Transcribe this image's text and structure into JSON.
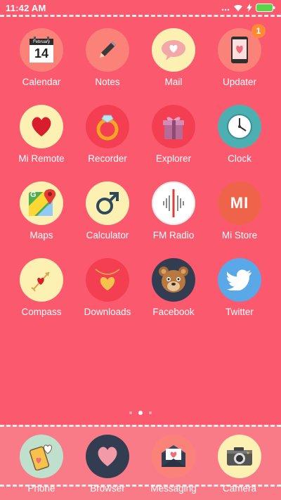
{
  "status_bar": {
    "time": "11:42 AM",
    "icons": [
      "more-icon",
      "wifi-icon",
      "charging-icon",
      "battery-icon"
    ]
  },
  "apps": [
    {
      "label": "Calendar",
      "month": "February",
      "day": "14",
      "icon": "calendar-icon"
    },
    {
      "label": "Notes",
      "icon": "pencil-icon"
    },
    {
      "label": "Mail",
      "icon": "speech-heart-icon"
    },
    {
      "label": "Updater",
      "icon": "phone-heart-icon",
      "badge": "1"
    },
    {
      "label": "Mi Remote",
      "icon": "heart-icon"
    },
    {
      "label": "Recorder",
      "icon": "ring-icon"
    },
    {
      "label": "Explorer",
      "icon": "gift-box-icon"
    },
    {
      "label": "Clock",
      "icon": "clock-icon"
    },
    {
      "label": "Maps",
      "icon": "maps-icon",
      "maps_letter": "G"
    },
    {
      "label": "Calculator",
      "icon": "male-symbol-icon"
    },
    {
      "label": "FM Radio",
      "icon": "radio-wave-icon"
    },
    {
      "label": "Mi Store",
      "icon": "mi-logo-icon",
      "logo_text": "MI"
    },
    {
      "label": "Compass",
      "icon": "arrow-heart-icon"
    },
    {
      "label": "Downloads",
      "icon": "heart-necklace-icon"
    },
    {
      "label": "Facebook",
      "icon": "teddy-bear-icon"
    },
    {
      "label": "Twitter",
      "icon": "twitter-bird-icon"
    }
  ],
  "page_indicator": {
    "pages": 3,
    "current": 2
  },
  "dock": [
    {
      "label": "Phone",
      "icon": "phone-hearts-icon"
    },
    {
      "label": "Browser",
      "icon": "heart-icon"
    },
    {
      "label": "Messaging",
      "icon": "envelope-heart-icon"
    },
    {
      "label": "Camera",
      "icon": "camera-icon"
    }
  ],
  "colors": {
    "background": "#fb5a6e",
    "dock": "#fa7b88",
    "cream": "#fdf0b3",
    "salmon": "#fb8278",
    "red_circle": "#f43f52",
    "teal": "#4cb0b3",
    "navy": "#333d52",
    "badge": "#ff8a34"
  }
}
